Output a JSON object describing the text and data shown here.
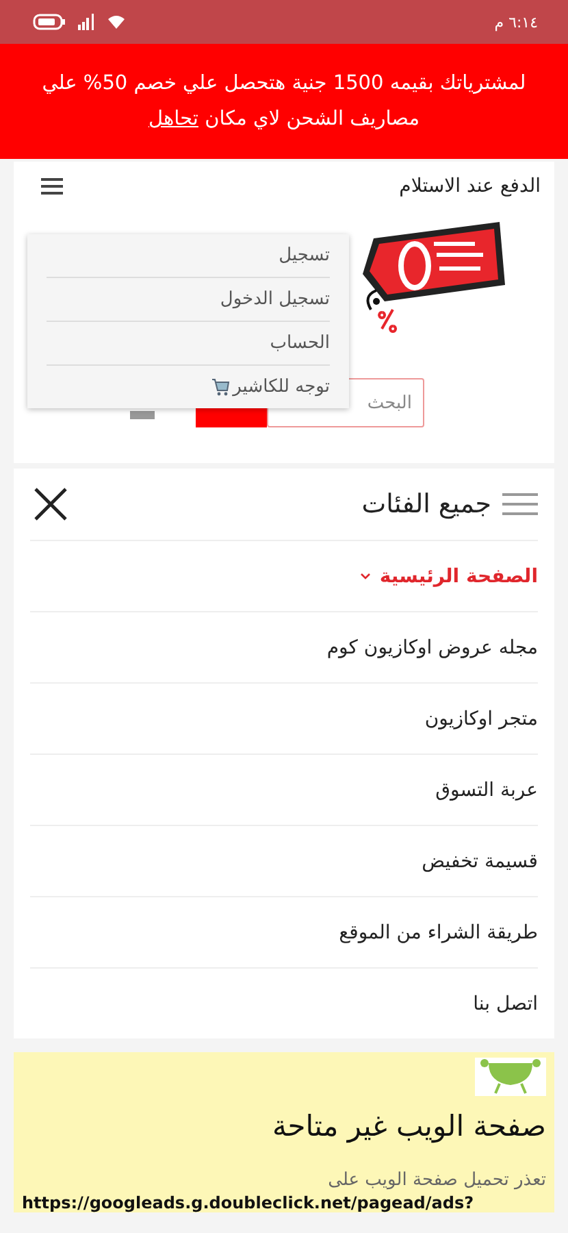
{
  "status_bar": {
    "time": "٦:١٤ م"
  },
  "banner": {
    "text": "لمشترياتك بقيمه 1500 جنية هتحصل علي خصم 50% علي مصاريف الشحن لاي مكان",
    "link": "تحاهل"
  },
  "header": {
    "title": "الدفع عند الاستلام"
  },
  "account_menu": {
    "items": [
      {
        "label": "تسجيل",
        "kind": "plain"
      },
      {
        "label": "تسجيل الدخول",
        "kind": "plain"
      },
      {
        "label": "الحساب",
        "kind": "plain"
      },
      {
        "label": "توجه للكاشير",
        "kind": "cart"
      }
    ]
  },
  "search": {
    "placeholder": "البحث"
  },
  "categories": {
    "title": "جميع الفئات",
    "items": [
      {
        "label": "الصفحة الرئيسية",
        "selected": true,
        "expandable": true
      },
      {
        "label": "مجله عروض اوكازيون كوم",
        "selected": false,
        "expandable": false
      },
      {
        "label": "متجر اوكازيون",
        "selected": false,
        "expandable": false
      },
      {
        "label": "عربة التسوق",
        "selected": false,
        "expandable": false
      },
      {
        "label": "قسيمة تخفيض",
        "selected": false,
        "expandable": false
      },
      {
        "label": "طريقة الشراء من الموقع",
        "selected": false,
        "expandable": false
      },
      {
        "label": "اتصل بنا",
        "selected": false,
        "expandable": false
      }
    ]
  },
  "error_page": {
    "title": "صفحة الويب غير متاحة",
    "message": "تعذر تحميل صفحة الويب على",
    "url": "https://googleads.g.doubleclick.net/pagead/ads?"
  }
}
